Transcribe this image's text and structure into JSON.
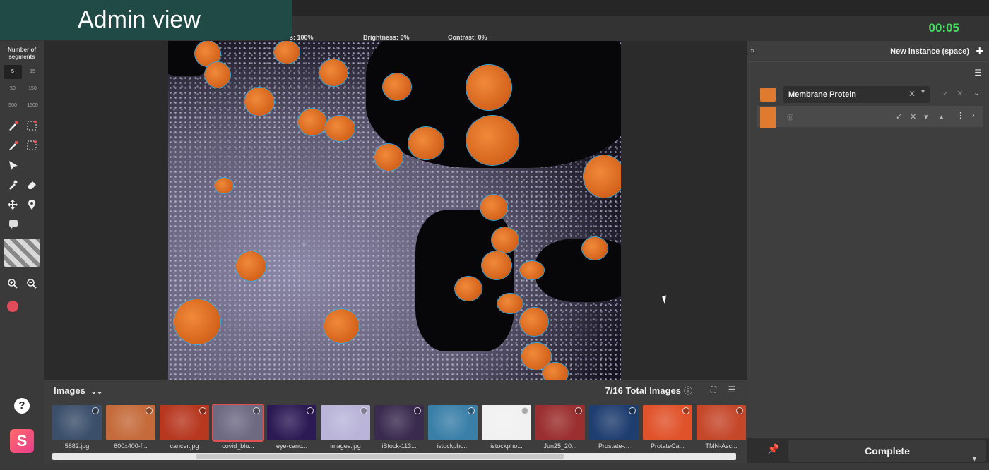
{
  "overlay": {
    "badge": "Admin view"
  },
  "toolbar": {
    "sliders": [
      {
        "label": "s: 100%",
        "value": 1.0
      },
      {
        "label": "Brightness: 0%",
        "value": 0.5
      },
      {
        "label": "Contrast: 0%",
        "value": 0.5
      }
    ],
    "timer": "00:05"
  },
  "left_tools": {
    "segments_title": "Number of segments",
    "segment_options": [
      "5",
      "15",
      "50",
      "150",
      "500",
      "1500"
    ],
    "active_segment": "5",
    "tools": [
      "brush-icon",
      "lasso-select-icon",
      "brush-icon",
      "polygon-select-icon",
      "pointer-icon",
      "eyedropper-icon",
      "eraser-icon",
      "move-icon",
      "location-pin-icon",
      "comment-icon",
      "zoom-in-icon",
      "zoom-out-icon"
    ],
    "help": "?",
    "brand": "S"
  },
  "images": {
    "title": "Images",
    "count": "7/16 Total Images",
    "thumbnails": [
      {
        "name": "5882.jpg",
        "color": "#3b4f6b"
      },
      {
        "name": "600x400-f...",
        "color": "#c56a3a"
      },
      {
        "name": "cancer.jpg",
        "color": "#b7371f"
      },
      {
        "name": "covid_blu...",
        "color": "#6e6a82"
      },
      {
        "name": "eye-canc...",
        "color": "#2c1a55"
      },
      {
        "name": "images.jpg",
        "color": "#b9b4d8"
      },
      {
        "name": "iStock-113...",
        "color": "#3a2a4e"
      },
      {
        "name": "istockpho...",
        "color": "#3a7fa8"
      },
      {
        "name": "istockpho...",
        "color": "#f1f1f1"
      },
      {
        "name": "Jun25_20...",
        "color": "#9b2e2e"
      },
      {
        "name": "Prostate-...",
        "color": "#1f3e70"
      },
      {
        "name": "ProtateCa...",
        "color": "#e0522a"
      },
      {
        "name": "TMN-Asc...",
        "color": "#c5472a"
      }
    ],
    "selected_index": 3
  },
  "right_panel": {
    "new_instance": "New instance (space)",
    "class_name": "Membrane Protein",
    "class_color": "#e07a2e",
    "complete": "Complete"
  }
}
